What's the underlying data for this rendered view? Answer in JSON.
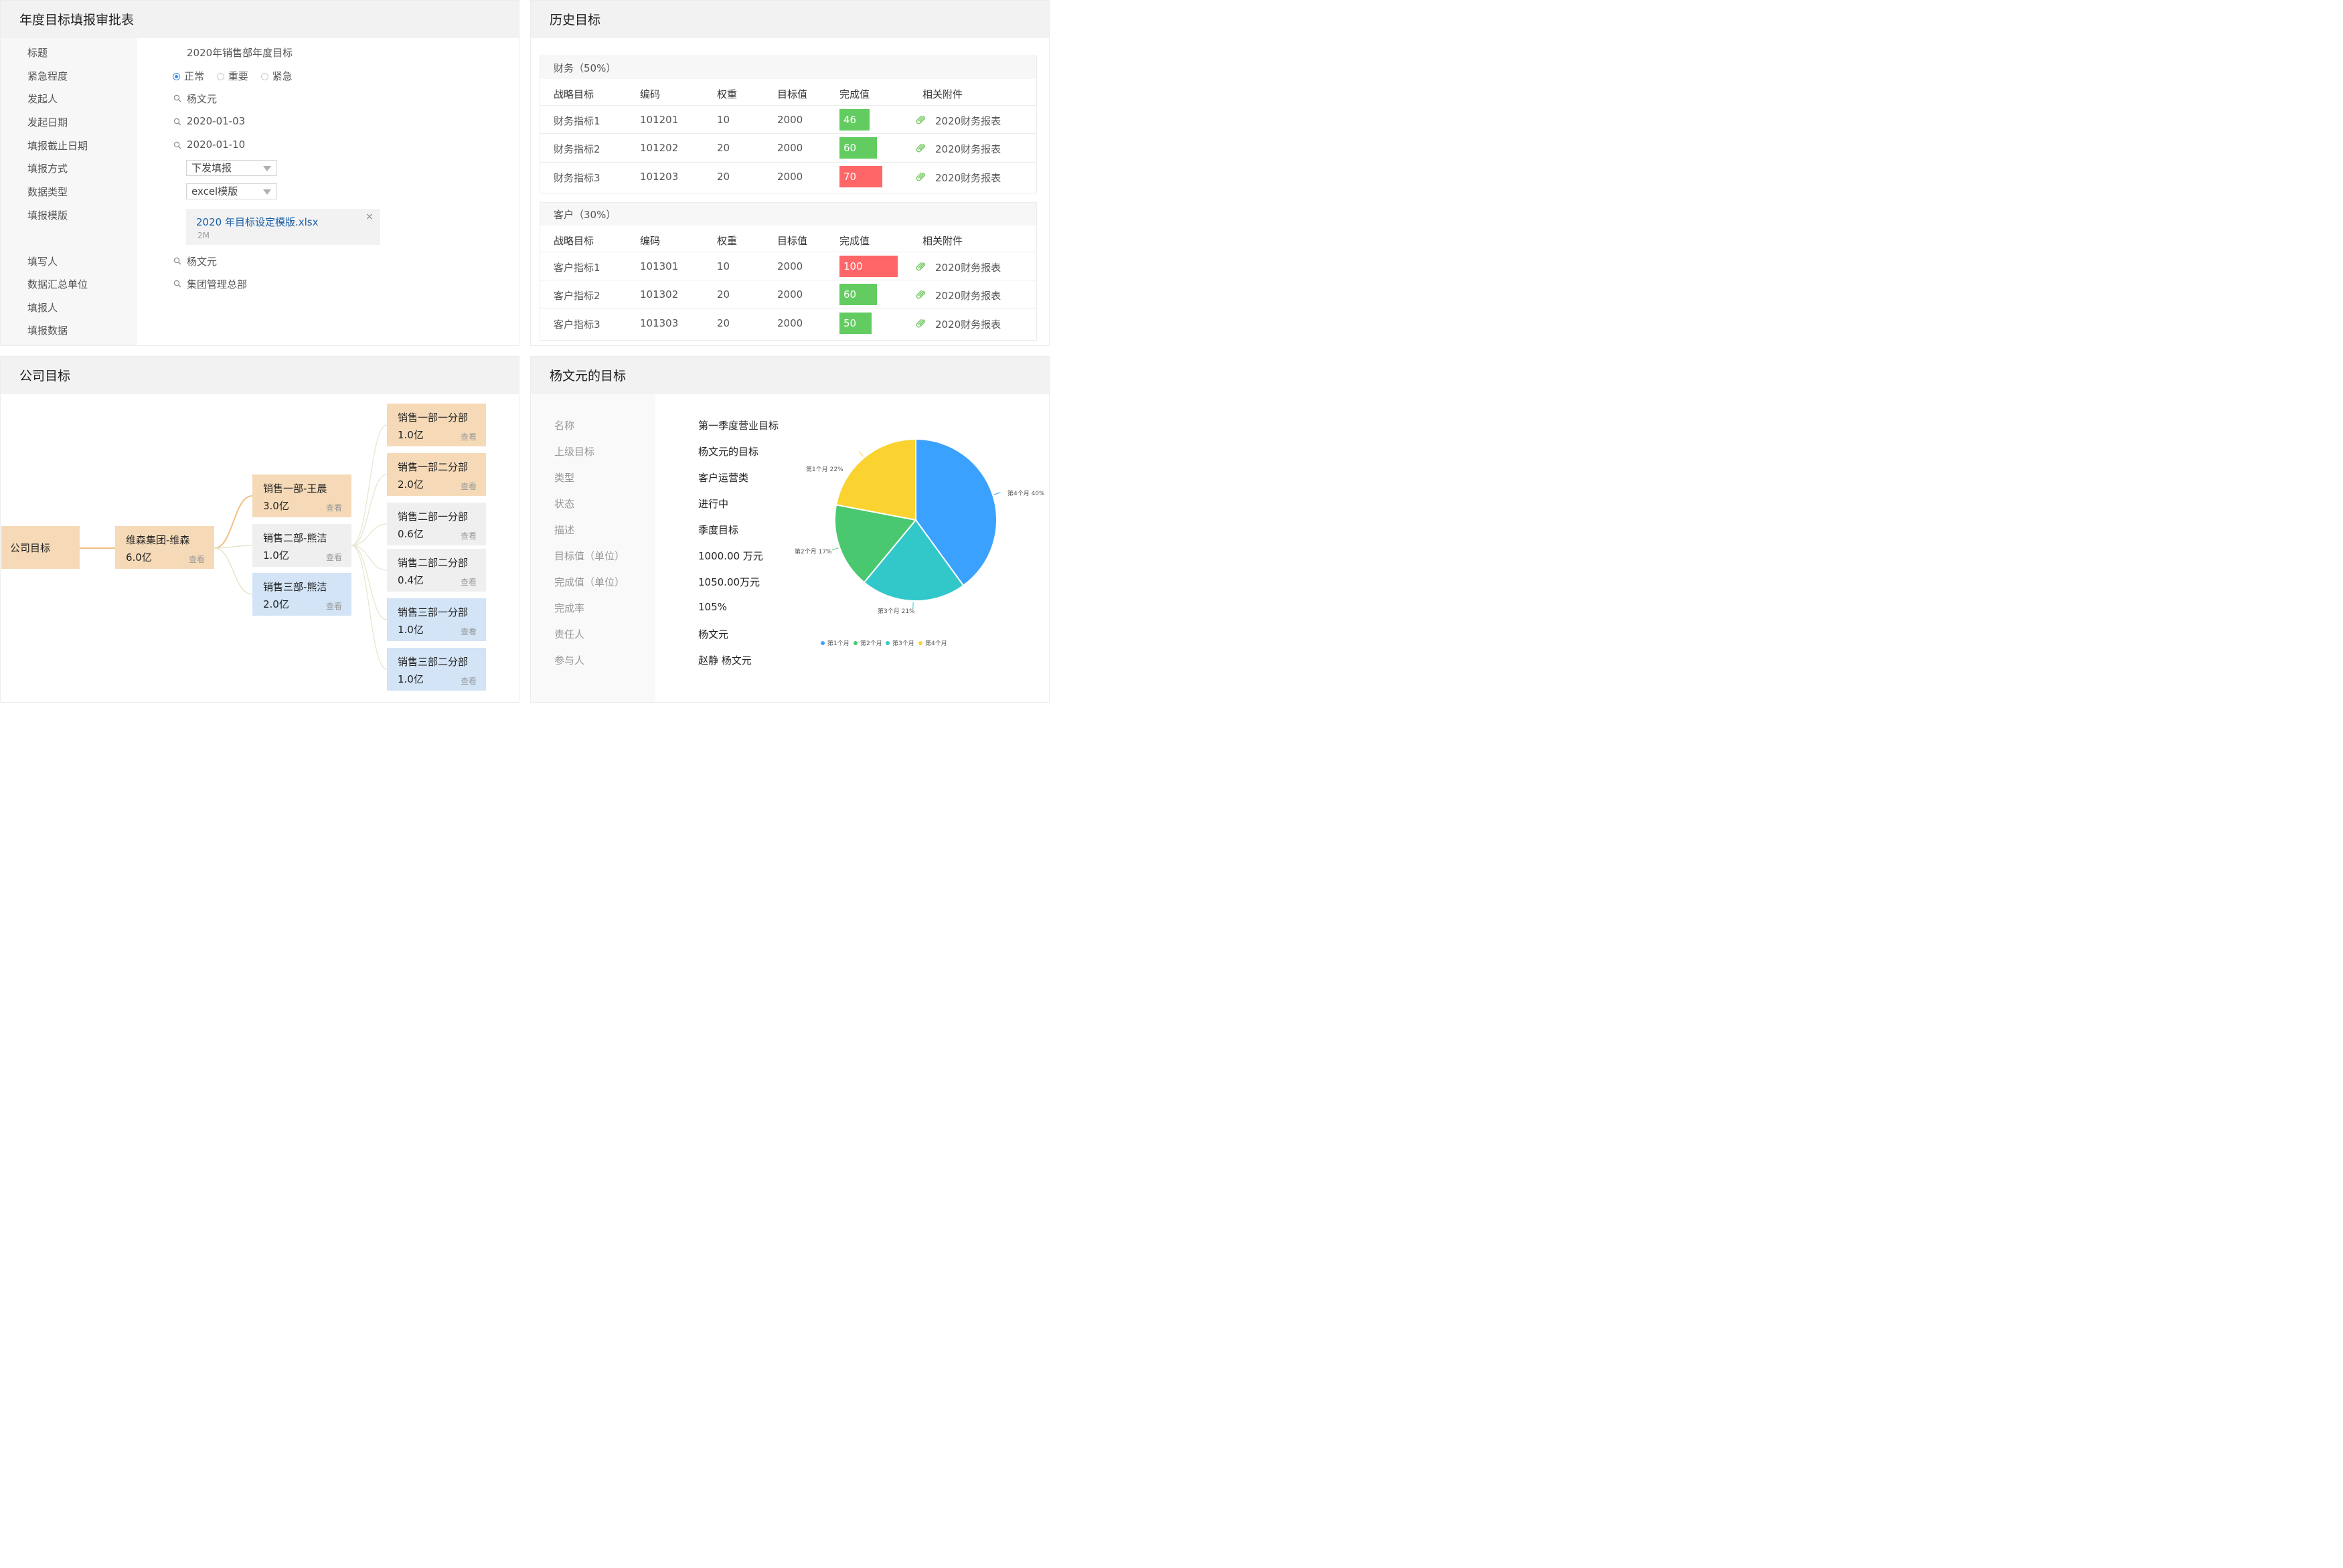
{
  "form": {
    "title": "年度目标填报审批表",
    "fields": [
      {
        "label": "标题",
        "value": "2020年销售部年度目标"
      },
      {
        "label": "紧急程度"
      },
      {
        "label": "发起人",
        "value": "杨文元"
      },
      {
        "label": "发起日期",
        "value": "2020-01-03"
      },
      {
        "label": "填报截止日期",
        "value": "2020-01-10"
      },
      {
        "label": "填报方式",
        "value": "下发填报"
      },
      {
        "label": "数据类型",
        "value": "excel模版"
      },
      {
        "label": "填报模版"
      },
      {
        "label": "填写人",
        "value": "杨文元"
      },
      {
        "label": "数据汇总单位",
        "value": "集团管理总部"
      },
      {
        "label": "填报人"
      },
      {
        "label": "填报数据"
      }
    ],
    "urgency_options": [
      "正常",
      "重要",
      "紧急"
    ],
    "urgency_selected": "正常",
    "file": {
      "name": "2020 年目标设定模版.xlsx",
      "size": "2M",
      "close": "×"
    },
    "icons": {
      "search": "search-icon",
      "dropdown": "triangle-down-icon",
      "close": "close-icon"
    }
  },
  "history": {
    "title": "历史目标",
    "headers": [
      "战略目标",
      "编码",
      "权重",
      "目标值",
      "完成值",
      "相关附件"
    ],
    "groups": [
      {
        "name": "财务（50%）",
        "rows": [
          {
            "name": "财务指标1",
            "code": "101201",
            "weight": "10",
            "target": "2000",
            "done": 46,
            "status": "green",
            "attachment": "2020财务报表"
          },
          {
            "name": "财务指标2",
            "code": "101202",
            "weight": "20",
            "target": "2000",
            "done": 60,
            "status": "green",
            "attachment": "2020财务报表"
          },
          {
            "name": "财务指标3",
            "code": "101203",
            "weight": "20",
            "target": "2000",
            "done": 70,
            "status": "red",
            "attachment": "2020财务报表"
          }
        ]
      },
      {
        "name": "客户（30%）",
        "rows": [
          {
            "name": "客户指标1",
            "code": "101301",
            "weight": "10",
            "target": "2000",
            "done": 100,
            "status": "red",
            "attachment": "2020财务报表"
          },
          {
            "name": "客户指标2",
            "code": "101302",
            "weight": "20",
            "target": "2000",
            "done": 60,
            "status": "green",
            "attachment": "2020财务报表"
          },
          {
            "name": "客户指标3",
            "code": "101303",
            "weight": "20",
            "target": "2000",
            "done": 50,
            "status": "green",
            "attachment": "2020财务报表"
          }
        ]
      }
    ],
    "colors": {
      "green": "#62cc60",
      "red": "#fe6667",
      "clip": "#7cc86a"
    },
    "icons": {
      "attachment": "paperclip-icon"
    }
  },
  "company": {
    "title": "公司目标",
    "view_label": "查看",
    "root": {
      "name": "公司目标"
    },
    "group": {
      "name": "维森集团-维森",
      "value": "6.0亿"
    },
    "depts": [
      {
        "name": "销售一部-王晨",
        "value": "3.0亿",
        "color": "orange"
      },
      {
        "name": "销售二部-熊洁",
        "value": "1.0亿",
        "color": "gray"
      },
      {
        "name": "销售三部-熊洁",
        "value": "2.0亿",
        "color": "blue"
      }
    ],
    "branches": [
      {
        "name": "销售一部一分部",
        "value": "1.0亿",
        "color": "orange"
      },
      {
        "name": "销售一部二分部",
        "value": "2.0亿",
        "color": "orange"
      },
      {
        "name": "销售二部一分部",
        "value": "0.6亿",
        "color": "gray"
      },
      {
        "name": "销售二部二分部",
        "value": "0.4亿",
        "color": "gray"
      },
      {
        "name": "销售三部一分部",
        "value": "1.0亿",
        "color": "blue"
      },
      {
        "name": "销售三部二分部",
        "value": "1.0亿",
        "color": "blue"
      }
    ],
    "colors": {
      "orange": "#f6dab8",
      "gray": "#efefef",
      "blue": "#d2e4f6",
      "link_main": "#f3bf84",
      "link_light": "#e6e4cc"
    }
  },
  "goal": {
    "title": "杨文元的目标",
    "fields": [
      {
        "label": "名称",
        "value": "第一季度营业目标"
      },
      {
        "label": "上级目标",
        "value": "杨文元的目标"
      },
      {
        "label": "类型",
        "value": "客户运营类"
      },
      {
        "label": "状态",
        "value": "进行中"
      },
      {
        "label": "描述",
        "value": "季度目标"
      },
      {
        "label": "目标值（单位）",
        "value": "1000.00 万元"
      },
      {
        "label": "完成值（单位）",
        "value": "1050.00万元"
      },
      {
        "label": "完成率",
        "value": "105%"
      },
      {
        "label": "责任人",
        "value": "杨文元"
      },
      {
        "label": "参与人",
        "value": "赵静 杨文元"
      }
    ]
  },
  "chart_data": {
    "type": "pie",
    "title": "",
    "categories": [
      "第1个月",
      "第2个月",
      "第3个月",
      "第4个月"
    ],
    "values": [
      22,
      17,
      21,
      40
    ],
    "slice_labels": [
      "第1个月 22%",
      "第2个月  17%",
      "第3个月  21%",
      "第4个月     40%"
    ],
    "colors": [
      "#fad331",
      "#49c86f",
      "#32c7c8",
      "#3aa1fe"
    ],
    "legend_position": "bottom"
  }
}
